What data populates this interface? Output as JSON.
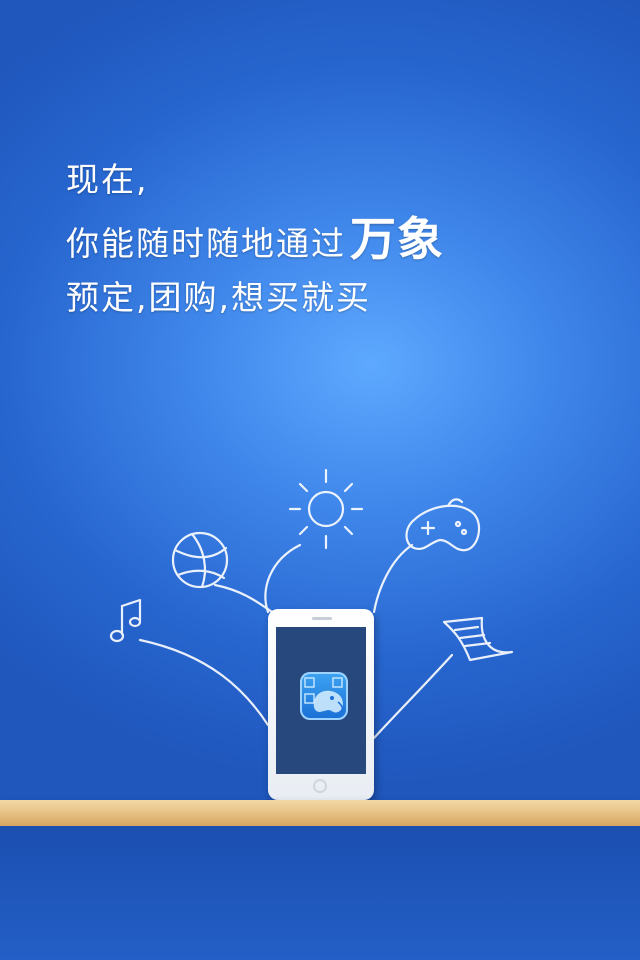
{
  "headline": {
    "line1": "现在,",
    "line2": "你能随时随地通过",
    "brand": "万象",
    "line3": "预定,团购,想买就买"
  },
  "icons": [
    "sun-icon",
    "basketball-icon",
    "music-note-icon",
    "gamepad-icon",
    "document-icon",
    "app-logo-icon"
  ],
  "colors": {
    "background": "#3f86ea",
    "shelf": "#e8c487",
    "screen": "#27487d"
  }
}
